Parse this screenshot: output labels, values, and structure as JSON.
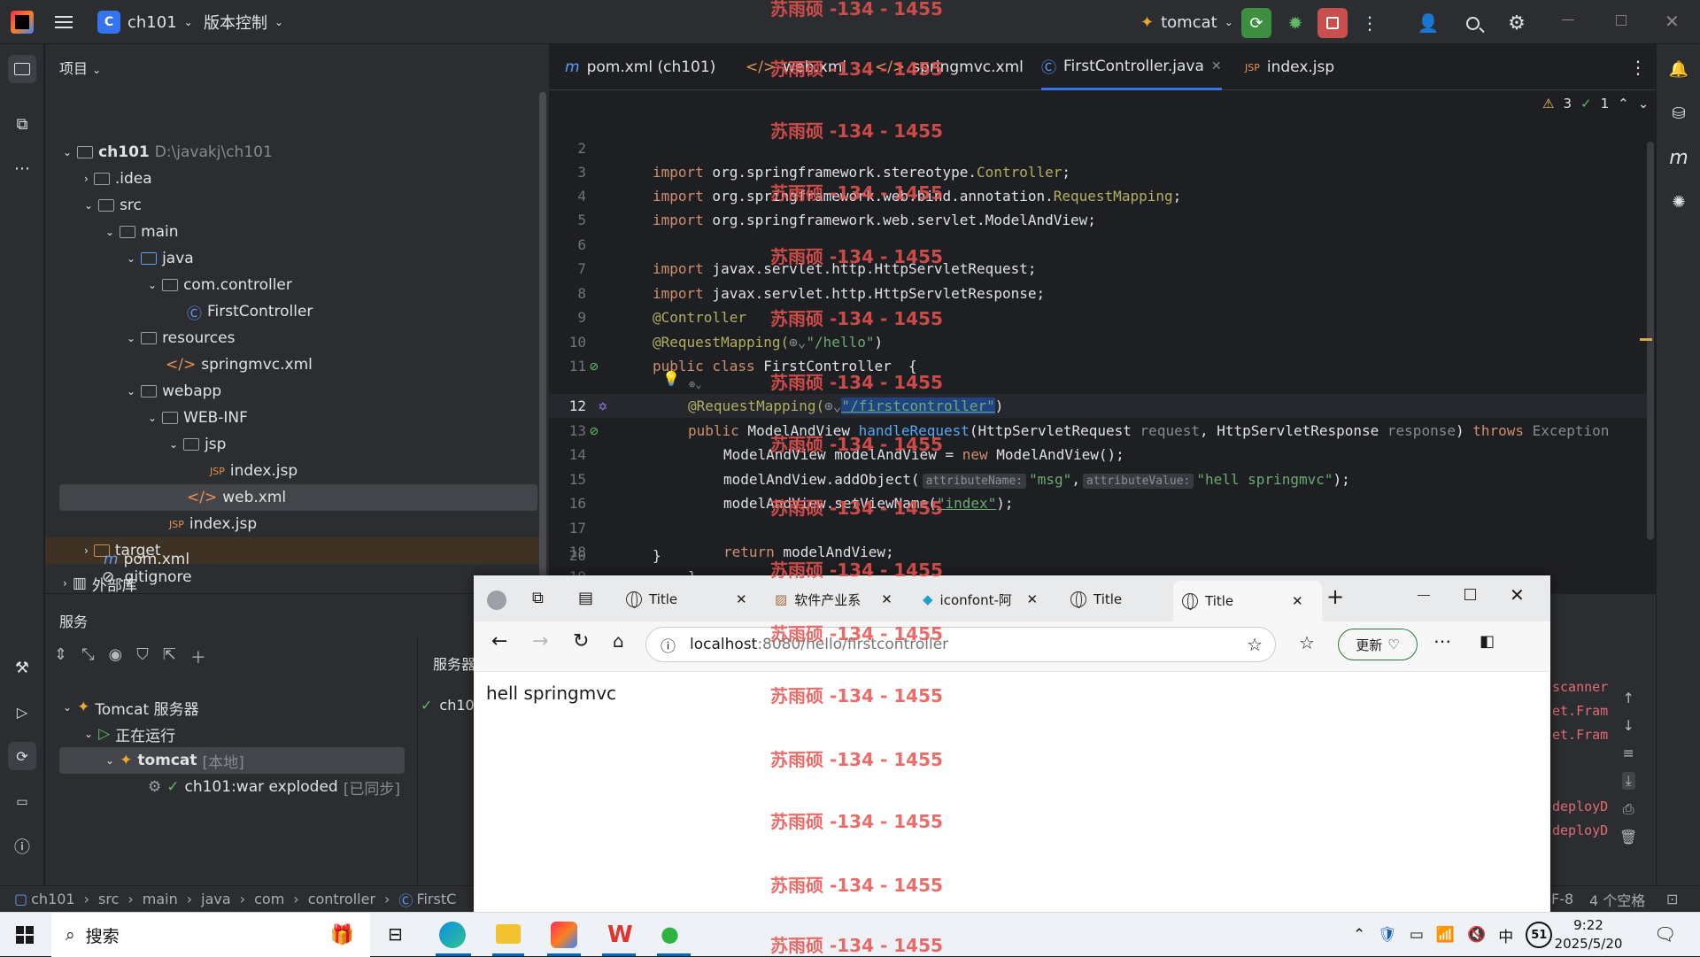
{
  "titlebar": {
    "project_name": "ch101",
    "project_initial": "C",
    "vcs_label": "版本控制",
    "run_config": "tomcat"
  },
  "project_panel": {
    "title": "项目",
    "root": {
      "name": "ch101",
      "path": "D:\\javakj\\ch101"
    },
    "items": [
      ".idea",
      "src",
      "main",
      "java",
      "com.controller",
      "FirstController",
      "resources",
      "springmvc.xml",
      "webapp",
      "WEB-INF",
      "jsp",
      "index.jsp",
      "web.xml",
      "index.jsp",
      "target",
      ".gitignore",
      "pom.xml",
      "外部库"
    ]
  },
  "editor": {
    "tabs": [
      "pom.xml (ch101)",
      "web.xml",
      "springmvc.xml",
      "FirstController.java",
      "index.jsp"
    ],
    "inspections": {
      "warnings": "3",
      "ok": "1"
    },
    "lines": {
      "n2": "2",
      "n3": "3",
      "n4": "4",
      "n5": "5",
      "n6": "6",
      "n7": "7",
      "n8": "8",
      "n9": "9",
      "n10": "10",
      "n11": "11",
      "n12": "12",
      "n13": "13",
      "n14": "14",
      "n15": "15",
      "n16": "16",
      "n17": "17",
      "n18": "18",
      "n19": "19",
      "n20": "20"
    },
    "code": {
      "l3_kw": "import",
      "l3": " org.springframework.stereotype.",
      "l3_cls": "Controller",
      "l3_end": ";",
      "l4_kw": "import",
      "l4": " org.springframework.web.bind.annotation.",
      "l4_cls": "RequestMapping",
      "l4_end": ";",
      "l5_kw": "import",
      "l5": " org.springframework.web.servlet.ModelAndView;",
      "l7_kw": "import",
      "l7": " javax.servlet.http.HttpServletRequest;",
      "l8_kw": "import",
      "l8": " javax.servlet.http.HttpServletResponse;",
      "l9": "@Controller",
      "l10": "@RequestMapping(",
      "l10_str": "\"/hello\"",
      "l10_end": ")",
      "l11_kw": "public class",
      "l11": " FirstController ",
      "l11_end": " {",
      "l12": "@RequestMapping(",
      "l12_str": "\"/firstcontroller\"",
      "l12_end": ")",
      "l13_kw": "public",
      "l13_a": " ModelAndView ",
      "l13_m": "handleRequest",
      "l13_b": "(HttpServletRequest ",
      "l13_p1": "request",
      ", ": "",
      "l13_c": ", HttpServletResponse ",
      "l13_p2": "response",
      "l13_d": ") ",
      "l13_kw2": "throws",
      "l13_e": " Exception",
      "l14_a": "ModelAndView modelAndView = ",
      "l14_kw": "new",
      "l14_b": " ModelAndView();",
      "l15_a": "modelAndView.addObject(",
      "l15_h1": "attributeName:",
      "l15_s1": "\"msg\"",
      "l15_c": ",",
      "l15_h2": "attributeValue:",
      "l15_s2": "\"hell springmvc\"",
      "l15_d": ");",
      "l16_a": "modelAndView.setViewName(",
      "l16_s": "\"index\"",
      "l16_b": ");",
      "l18_kw": "return",
      "l18": " modelAndView;",
      "l19": "}",
      "l20": "}"
    }
  },
  "services": {
    "title": "服务",
    "tab_label": "服务器",
    "server": "Tomcat 服务器",
    "status": "正在运行",
    "instance": "tomcat",
    "instance_tag": "[本地]",
    "artifact": "ch101:war exploded",
    "artifact_tag": "[已同步]",
    "deploy_item": "ch10",
    "log_lines": [
      "scanner",
      "et.Fram",
      "et.Fram",
      "deployD",
      "deployD"
    ]
  },
  "breadcrumb": [
    "ch101",
    "src",
    "main",
    "java",
    "com",
    "controller",
    "FirstC"
  ],
  "status_right": {
    "encoding": "F-8",
    "indent": "4 个空格"
  },
  "browser": {
    "tabs": [
      "Title",
      "软件产业系",
      "iconfont-阿",
      "Title",
      "Title"
    ],
    "url_host": "localhost",
    "url_rest": ":8080/hello/firstcontroller",
    "update_label": "更新",
    "page_text": "hell springmvc"
  },
  "taskbar": {
    "search": "搜索",
    "time": "9:22",
    "date": "2025/5/20",
    "ime": "中",
    "badge": "51"
  },
  "watermark": "苏雨硕 -134 - 1455",
  "colors": {
    "accent": "#3574f0",
    "run_green": "#3e8e41",
    "stop_red": "#c94f4f",
    "watermark": "#e8534f"
  }
}
